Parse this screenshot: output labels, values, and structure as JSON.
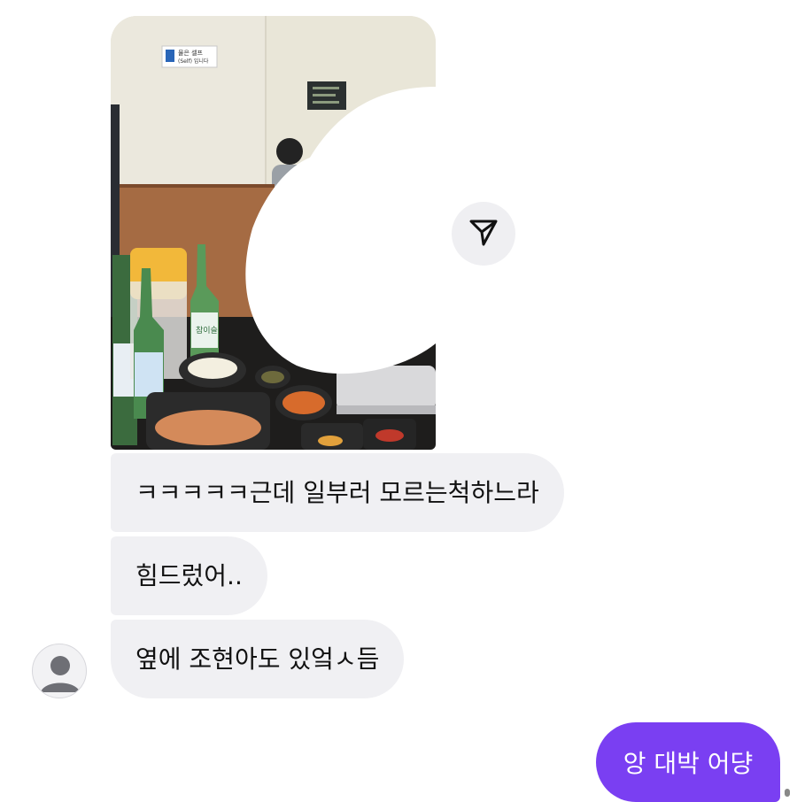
{
  "chat": {
    "incoming": [
      {
        "text": "ㅋㅋㅋㅋㅋ근데 일부러 모르는척하느라"
      },
      {
        "text": "힘드렀어.."
      },
      {
        "text": "옆에 조현아도 있엌ㅅ듬"
      }
    ],
    "outgoing": [
      {
        "text": "앙 대박 어댱"
      }
    ]
  },
  "photo": {
    "sign_text_line1": "물은 셀프",
    "sign_text_line2": "(Self) 입니다",
    "bottle_label": "참이슬"
  },
  "icons": {
    "share": "paper-plane-icon",
    "avatar": "default-user-icon"
  },
  "colors": {
    "incoming_bubble": "#f0f0f3",
    "outgoing_bubble": "#7a3ff2",
    "share_button_bg": "#efeff2"
  }
}
